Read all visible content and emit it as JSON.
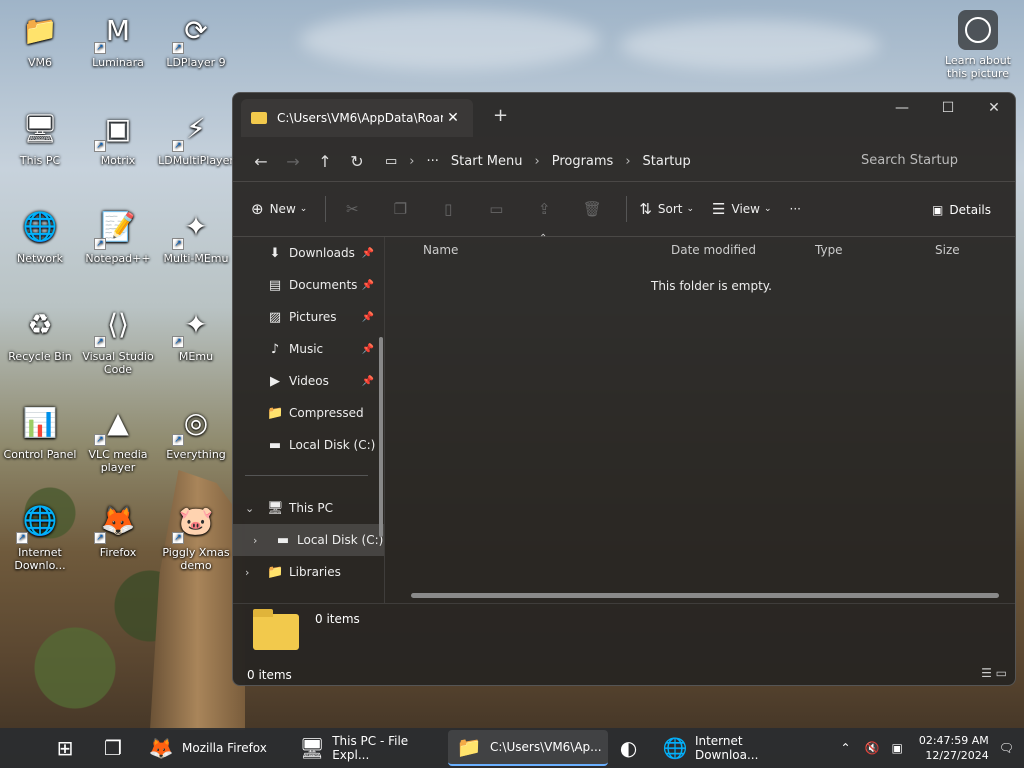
{
  "desktop": {
    "icons": [
      {
        "label": "VM6",
        "icon": "folder-icon",
        "glyph": "📁",
        "shortcut": false
      },
      {
        "label": "Luminara",
        "icon": "luminara-icon",
        "glyph": "M",
        "shortcut": true
      },
      {
        "label": "LDPlayer 9",
        "icon": "ldplayer-icon",
        "glyph": "⟳",
        "shortcut": true
      },
      {
        "label": "This PC",
        "icon": "monitor-icon",
        "glyph": "🖥",
        "shortcut": false
      },
      {
        "label": "Motrix",
        "icon": "motrix-icon",
        "glyph": "▣",
        "shortcut": true
      },
      {
        "label": "LDMultiPlayer",
        "icon": "ldmultiplayer-icon",
        "glyph": "⚡",
        "shortcut": true
      },
      {
        "label": "Network",
        "icon": "network-icon",
        "glyph": "🌐",
        "shortcut": false
      },
      {
        "label": "Notepad++",
        "icon": "notepad-icon",
        "glyph": "📝",
        "shortcut": true
      },
      {
        "label": "Multi-MEmu",
        "icon": "multimemu-icon",
        "glyph": "✦",
        "shortcut": true
      },
      {
        "label": "Recycle Bin",
        "icon": "recycle-bin-icon",
        "glyph": "♻",
        "shortcut": false
      },
      {
        "label": "Visual Studio Code",
        "icon": "vscode-icon",
        "glyph": "⟨⟩",
        "shortcut": true
      },
      {
        "label": "MEmu",
        "icon": "memu-icon",
        "glyph": "✦",
        "shortcut": true
      },
      {
        "label": "Control Panel",
        "icon": "control-panel-icon",
        "glyph": "📊",
        "shortcut": false
      },
      {
        "label": "VLC media player",
        "icon": "vlc-icon",
        "glyph": "▲",
        "shortcut": true
      },
      {
        "label": "Everything",
        "icon": "everything-icon",
        "glyph": "◎",
        "shortcut": true
      },
      {
        "label": "Internet Downlo...",
        "icon": "idm-icon",
        "glyph": "🌐",
        "shortcut": true
      },
      {
        "label": "Firefox",
        "icon": "firefox-icon",
        "glyph": "🦊",
        "shortcut": true
      },
      {
        "label": "Piggly Xmas demo",
        "icon": "piggly-icon",
        "glyph": "🐷",
        "shortcut": true
      }
    ],
    "learn": "Learn about this picture"
  },
  "explorer": {
    "tab_title": "C:\\Users\\VM6\\AppData\\Roam",
    "window_controls": {
      "minimize": "—",
      "maximize": "☐",
      "close": "✕"
    },
    "breadcrumb": [
      "Start Menu",
      "Programs",
      "Startup"
    ],
    "ellipsis": "···",
    "search_placeholder": "Search Startup",
    "toolbar": {
      "new": "New",
      "sort": "Sort",
      "view": "View",
      "more": "···",
      "details": "Details"
    },
    "nav": [
      {
        "label": "Downloads",
        "icon": "download-icon",
        "glyph": "⬇",
        "pin": true
      },
      {
        "label": "Documents",
        "icon": "document-icon",
        "glyph": "▤",
        "pin": true
      },
      {
        "label": "Pictures",
        "icon": "pictures-icon",
        "glyph": "▨",
        "pin": true
      },
      {
        "label": "Music",
        "icon": "music-icon",
        "glyph": "♪",
        "pin": true
      },
      {
        "label": "Videos",
        "icon": "videos-icon",
        "glyph": "▶",
        "pin": true
      },
      {
        "label": "Compressed",
        "icon": "folder-icon",
        "glyph": "📁",
        "pin": false
      },
      {
        "label": "Local Disk (C:)",
        "icon": "disk-icon",
        "glyph": "▬",
        "pin": false
      }
    ],
    "tree": [
      {
        "label": "This PC",
        "icon": "monitor-icon",
        "glyph": "🖥",
        "expander": "⌄"
      },
      {
        "label": "Local Disk (C:)",
        "icon": "disk-icon",
        "glyph": "▬",
        "expander": "›"
      },
      {
        "label": "Libraries",
        "icon": "folder-icon",
        "glyph": "📁",
        "expander": "›"
      }
    ],
    "columns": {
      "name": "Name",
      "date": "Date modified",
      "type": "Type",
      "size": "Size"
    },
    "empty_message": "This folder is empty.",
    "items_count": "0 items",
    "status_count": "0 items"
  },
  "taskbar": {
    "items": [
      {
        "label": "",
        "icon": "start-icon",
        "glyph": "⊞"
      },
      {
        "label": "",
        "icon": "task-view-icon",
        "glyph": "❐"
      },
      {
        "label": "Mozilla Firefox",
        "icon": "firefox-icon",
        "glyph": "🦊"
      },
      {
        "label": "This PC - File Expl...",
        "icon": "monitor-icon",
        "glyph": "🖥"
      },
      {
        "label": "C:\\Users\\VM6\\Ap...",
        "icon": "folder-icon",
        "glyph": "📁"
      },
      {
        "label": "",
        "icon": "edge-icon",
        "glyph": "◐"
      },
      {
        "label": "Internet Downloa...",
        "icon": "idm-icon",
        "glyph": "🌐"
      }
    ],
    "time": "02:47:59 AM",
    "date": "12/27/2024"
  }
}
